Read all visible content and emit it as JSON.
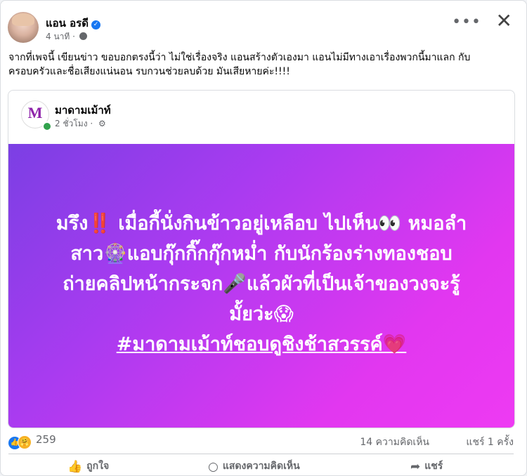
{
  "post": {
    "author": "แอน อรดี",
    "time": "4 นาที",
    "text": "จากที่เพจนี้ เขียนข่าว ขอบอกตรงนี้ว่า ไม่ใช่เรื่องจริง แอนสร้างตัวเองมา แอนไม่มีทางเอาเรื่องพวกนี้มาแลก กับ ครอบครัวและชื่อเสียงแน่นอน รบกวนช่วยลบด้วย มันเสียหายค่ะ!!!!"
  },
  "shared": {
    "page_name": "มาดามเม้าท์",
    "time": "2 ชั่วโมง",
    "logo_letter": "M",
    "logo_caption": "มาดามเม้าท์",
    "banner_lines": [
      "มรึง‼️ เมื่อกี้นั่งกินข้าวอยู่เหลือบ ไปเห็น👀 หมอลำ",
      "สาว🎡แอบกุ๊กกิ๊กกุ๊กหม่ำ กับนักร้องร่างทองชอบ",
      "ถ่ายคลิปหน้ากระจก🎤แล้วผัวที่เป็นเจ้าของวงจะรู้",
      "มั้ยว่ะ😱"
    ],
    "hashtag": "#มาดามเม้าท์ชอบดูชิงช้าสวรรค์💗"
  },
  "stats": {
    "reaction_count": "259",
    "comments": "14 ความคิดเห็น",
    "shares": "แชร์ 1 ครั้ง"
  },
  "actions": {
    "like": "ถูกใจ",
    "comment": "แสดงความคิดเห็น",
    "share": "แชร์"
  },
  "colors": {
    "banner_start": "#7b3fe4",
    "banner_end": "#ee3af3",
    "verified": "#1877f2"
  }
}
